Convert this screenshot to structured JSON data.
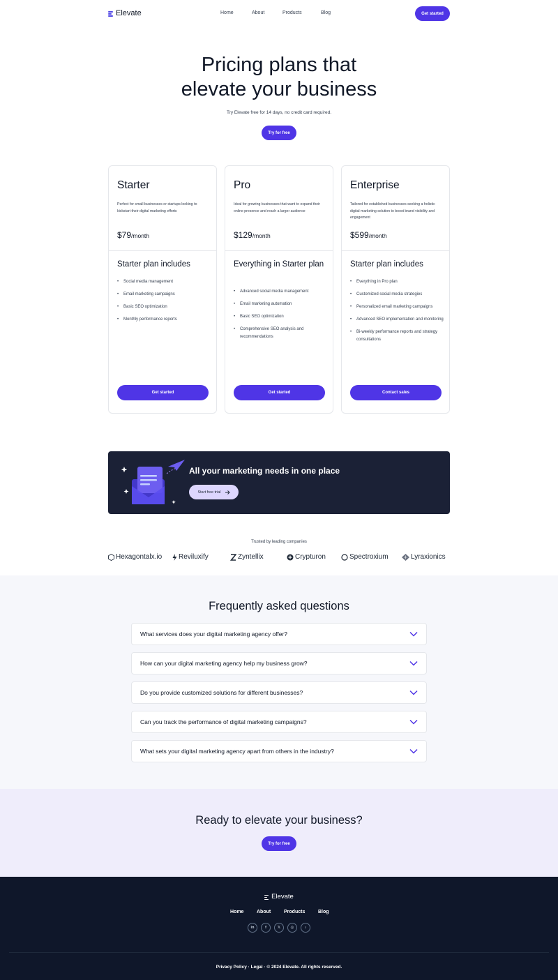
{
  "brand": {
    "name": "Elevate",
    "accent": "#4f35e6",
    "dark": "#0f172a"
  },
  "nav": {
    "links": [
      "Home",
      "About",
      "Products",
      "Blog"
    ],
    "cta": "Get started"
  },
  "hero": {
    "title_line1": "Pricing plans that",
    "title_line2": "elevate your business",
    "subtitle": "Try Elevate free for 14 days, no credit card required.",
    "cta": "Try for free"
  },
  "plans": [
    {
      "name": "Starter",
      "description": "Perfect for small businesses or startups looking to kickstart their digital marketing efforts",
      "price": "$79",
      "period": "/month",
      "includes_title": "Starter plan includes",
      "features": [
        "Social media management",
        "Email marketing campaigns",
        "Basic SEO optimization",
        "Monthly performance reports"
      ],
      "cta": "Get started"
    },
    {
      "name": "Pro",
      "description": "Ideal for growing businesses that want to expand their online presence and reach a larger audience",
      "price": "$129",
      "period": "/month",
      "includes_title": "Everything in Starter plan",
      "features": [
        "Advanced social media management",
        "Email marketing automation",
        "Basic SEO optimization",
        "Comprehensive SEO analysis and recommendations"
      ],
      "cta": "Get started"
    },
    {
      "name": "Enterprise",
      "description": "Tailored for established businesses seeking a holistic digital marketing solution to boost brand visibility and engagement",
      "price": "$599",
      "period": "/month",
      "includes_title": "Starter plan includes",
      "features": [
        "Everything in Pro plan",
        "Customized social media strategies",
        "Personalized email marketing campaigns",
        "Advanced SEO implementation and monitoring",
        "Bi-weekly performance reports and strategy consultations"
      ],
      "cta": "Contact sales"
    }
  ],
  "banner": {
    "title": "All your marketing needs in one place",
    "cta": "Start free trial",
    "arrow_icon": "arrow-right-icon"
  },
  "trusted": {
    "label": "Trusted by leading companies",
    "companies": [
      "Hexagontalx.io",
      "Reviluxify",
      "Zyntellix",
      "Crypturon",
      "Spectroxium",
      "Lyraxionics"
    ]
  },
  "faq": {
    "title": "Frequently asked questions",
    "items": [
      "What services does your digital marketing agency offer?",
      "How can your digital marketing agency help my business grow?",
      "Do you provide customized solutions for different businesses?",
      "Can you track the performance of digital marketing campaigns?",
      "What sets your digital marketing agency apart from others in the industry?"
    ]
  },
  "cta_section": {
    "title": "Ready to elevate your business?",
    "cta": "Try for free"
  },
  "footer": {
    "brand": "Elevate",
    "links": [
      "Home",
      "About",
      "Products",
      "Blog"
    ],
    "socials": [
      "linkedin-icon",
      "facebook-icon",
      "x-icon",
      "instagram-icon",
      "tiktok-icon"
    ],
    "social_glyphs": [
      "in",
      "f",
      "𝕏",
      "◎",
      "♪"
    ],
    "copyright": "Privacy Policy · Legal · © 2024 Elevate. All rights reserved."
  }
}
